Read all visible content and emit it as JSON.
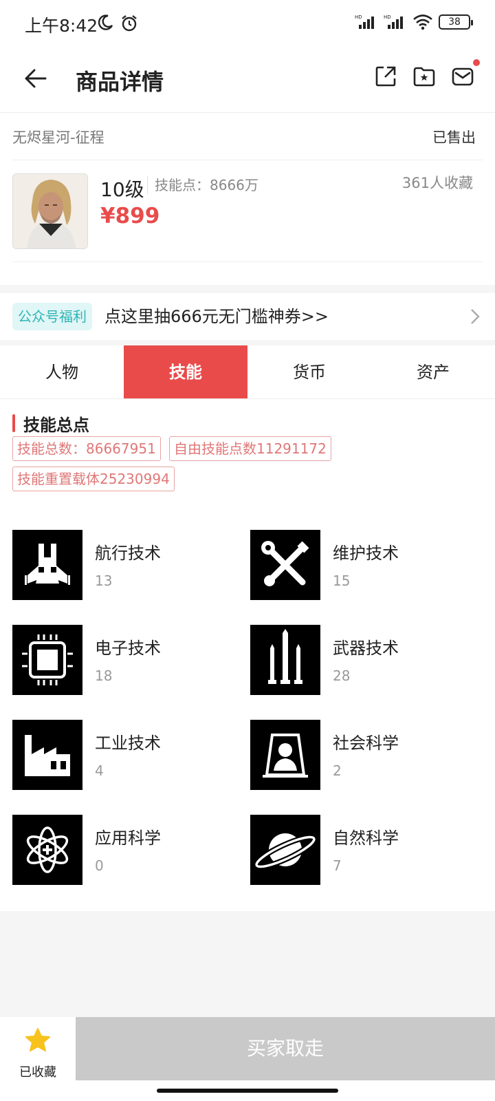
{
  "status": {
    "time": "上午8:42",
    "battery": "38"
  },
  "nav": {
    "title": "商品详情"
  },
  "product": {
    "game": "无烬星河-征程",
    "sale_status": "已售出",
    "level": "10级",
    "skill_points": "技能点：8666万",
    "favorites": "361人收藏",
    "price": "¥899"
  },
  "promo": {
    "badge": "公众号福利",
    "text": "点这里抽666元无门槛神券>>"
  },
  "tabs": [
    {
      "label": "人物"
    },
    {
      "label": "技能"
    },
    {
      "label": "货币"
    },
    {
      "label": "资产"
    }
  ],
  "active_tab": "技能",
  "skills_section": {
    "title": "技能总点",
    "tags": [
      "技能总数：86667951",
      "自由技能点数11291172",
      "技能重置载体25230994"
    ],
    "items": [
      {
        "name": "航行技术",
        "value": "13",
        "icon": "spaceship-icon"
      },
      {
        "name": "维护技术",
        "value": "15",
        "icon": "wrench-screwdriver-icon"
      },
      {
        "name": "电子技术",
        "value": "18",
        "icon": "chip-icon"
      },
      {
        "name": "武器技术",
        "value": "28",
        "icon": "missiles-icon"
      },
      {
        "name": "工业技术",
        "value": "4",
        "icon": "factory-icon"
      },
      {
        "name": "社会科学",
        "value": "2",
        "icon": "person-portrait-icon"
      },
      {
        "name": "应用科学",
        "value": "0",
        "icon": "atom-star-icon"
      },
      {
        "name": "自然科学",
        "value": "7",
        "icon": "planet-icon"
      }
    ]
  },
  "bottom": {
    "favorite_label": "已收藏",
    "buy_label": "买家取走"
  },
  "colors": {
    "accent": "#e94b4b",
    "promo": "#2fb5b5",
    "disabled": "#c9c9c9",
    "star": "#f7c21b"
  }
}
